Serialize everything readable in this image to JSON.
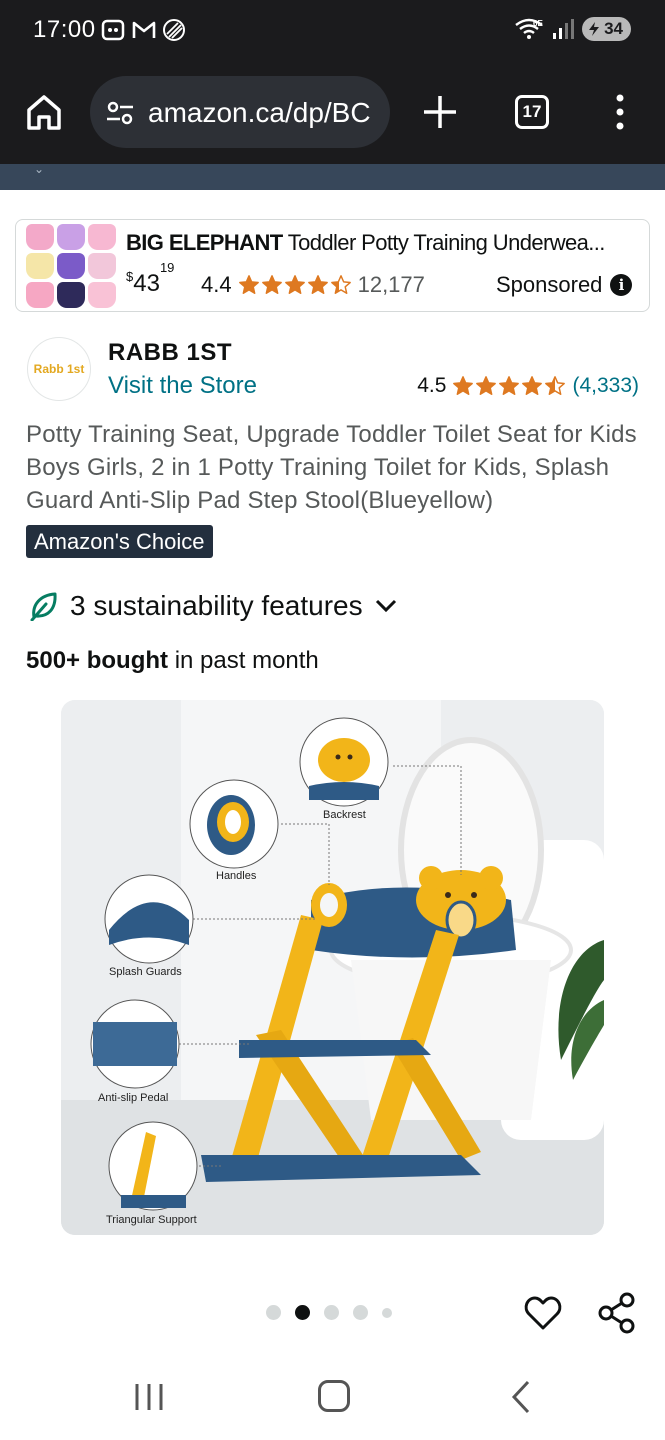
{
  "status_bar": {
    "time": "17:00",
    "network": "6E",
    "battery": "34",
    "icons": [
      "screenshot-icon",
      "gmail-icon",
      "data-saver-icon",
      "wifi-icon",
      "signal-icon",
      "battery-icon"
    ]
  },
  "browser": {
    "url": "amazon.ca/dp/BC",
    "tab_count": "17",
    "icons": [
      "home-icon",
      "site-settings-icon",
      "new-tab-icon",
      "tabs-icon",
      "more-menu-icon"
    ]
  },
  "sponsored_ad": {
    "brand": "BIG ELEPHANT",
    "title_rest": " Toddler Potty Training Underwea...",
    "price_currency": "$",
    "price_whole": "43",
    "price_fraction": "19",
    "rating": "4.4",
    "rating_value": 4.4,
    "review_count": "12,177",
    "sponsored_label": "Sponsored"
  },
  "product": {
    "brand_logo_text": "Rabb 1st",
    "brand_name": "RABB 1ST",
    "store_link": "Visit the Store",
    "rating": "4.5",
    "rating_value": 4.5,
    "review_count": "(4,333)",
    "title": "Potty Training Seat, Upgrade Toddler Toilet Seat for Kids Boys Girls, 2 in 1 Potty Training Toilet for Kids, Splash Guard Anti-Slip Pad Step Stool(Blueyellow)",
    "badge": "Amazon's Choice",
    "sustainability": "3 sustainability features",
    "bought_bold": "500+ bought",
    "bought_rest": " in past month"
  },
  "product_image": {
    "labels": {
      "backrest": "Backrest",
      "handles": "Handles",
      "splash_guards": "Splash Guards",
      "anti_slip": "Anti-slip Pedal",
      "triangular": "Triangular Support"
    }
  },
  "carousel": {
    "total_dots": 5,
    "active_index": 1
  },
  "colors": {
    "status_bg": "#1b1b1d",
    "link": "#007185",
    "star": "#de7921",
    "badge_bg": "#232f3e",
    "leaf": "#067d62",
    "step_yellow": "#f2b519",
    "step_blue": "#2e5a86"
  }
}
